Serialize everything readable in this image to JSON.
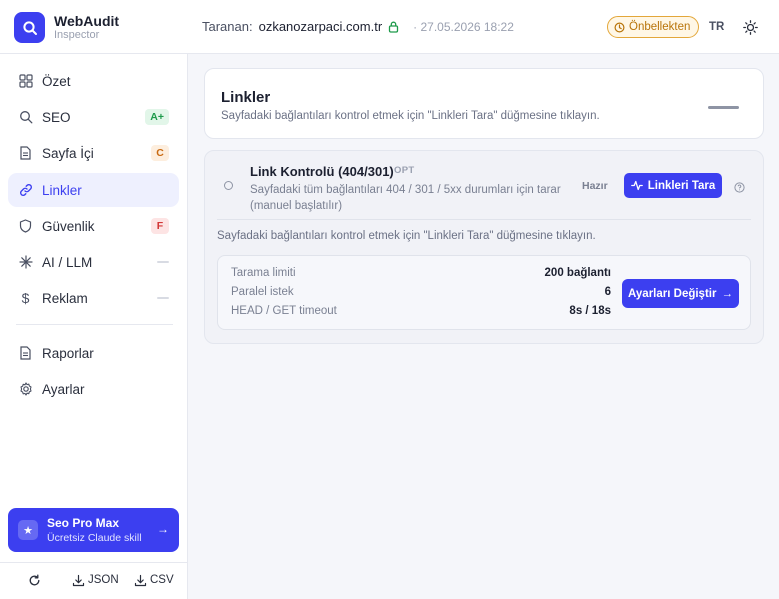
{
  "app": {
    "name": "WebAudit",
    "subtitle": "Inspector"
  },
  "header": {
    "scan_label": "Taranan:",
    "domain": "ozkanozarpaci.com.tr",
    "date": "· 27.05.2026 18:22",
    "cache_badge": "Önbellekten",
    "language": "TR"
  },
  "sidebar": {
    "items": [
      {
        "label": "Özet",
        "badge": ""
      },
      {
        "label": "SEO",
        "badge": "A+"
      },
      {
        "label": "Sayfa İçi",
        "badge": "C"
      },
      {
        "label": "Linkler",
        "badge": ""
      },
      {
        "label": "Güvenlik",
        "badge": "F"
      },
      {
        "label": "AI / LLM",
        "badge": ""
      },
      {
        "label": "Reklam",
        "badge": ""
      },
      {
        "label": "Raporlar",
        "badge": ""
      },
      {
        "label": "Ayarlar",
        "badge": ""
      }
    ],
    "promo": {
      "title": "Seo Pro Max",
      "subtitle": "Ücretsiz Claude skill"
    },
    "footer": {
      "json_label": "JSON",
      "csv_label": "CSV"
    }
  },
  "main": {
    "title": "Linkler",
    "subtitle": "Sayfadaki bağlantıları kontrol etmek için \"Linkleri Tara\" düğmesine tıklayın.",
    "check": {
      "title": "Link Kontrolü (404/301)",
      "tag": "OPT",
      "description": "Sayfadaki tüm bağlantıları 404 / 301 / 5xx durumları için tarar (manuel başlatılır)",
      "status": "Hazır",
      "button": "Linkleri Tara",
      "note": "Sayfadaki bağlantıları kontrol etmek için \"Linkleri Tara\" düğmesine tıklayın.",
      "settings": [
        {
          "label": "Tarama limiti",
          "value": "200 bağlantı"
        },
        {
          "label": "Paralel istek",
          "value": "6"
        },
        {
          "label": "HEAD / GET timeout",
          "value": "8s / 18s"
        }
      ],
      "settings_button": "Ayarları Değiştir"
    }
  },
  "colors": {
    "accent": "#3c3ff0",
    "cache": "#e3a73a",
    "lock": "#1e9a4a"
  }
}
